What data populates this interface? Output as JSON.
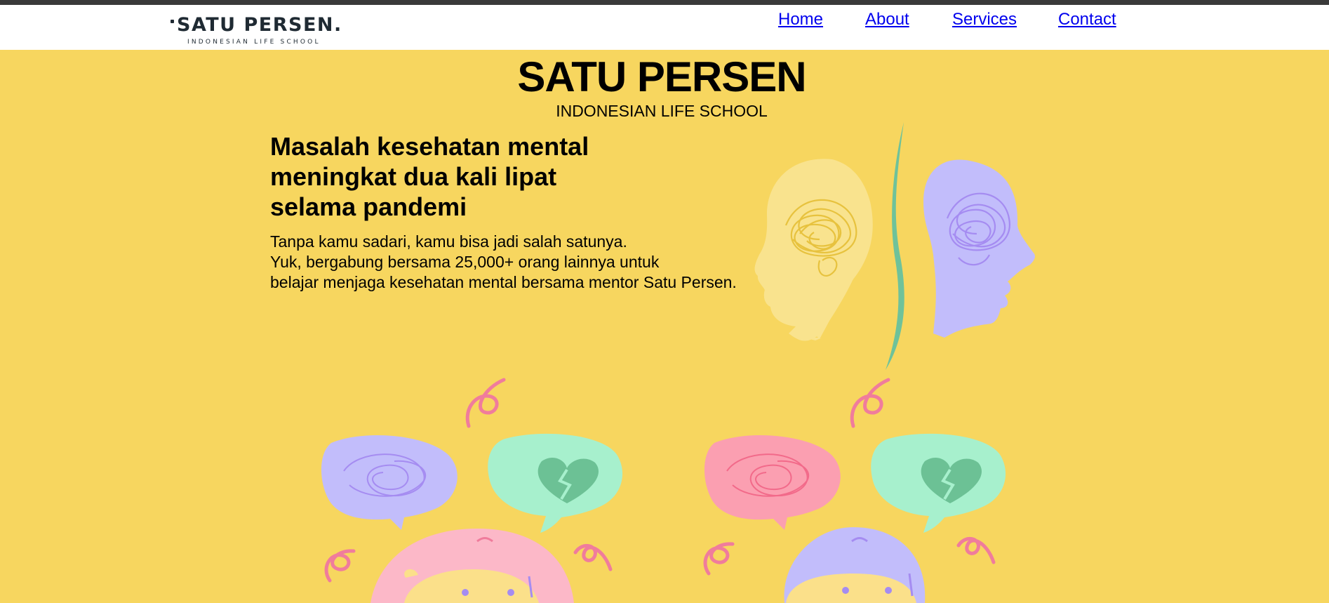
{
  "nav": {
    "logo": {
      "name": "SATU PERSEN",
      "suffix": ".",
      "tagline": "INDONESIAN LIFE SCHOOL"
    },
    "links": [
      "Home",
      "About",
      "Services",
      "Contact"
    ]
  },
  "hero": {
    "title": "SATU PERSEN",
    "subtitle": "INDONESIAN LIFE SCHOOL",
    "headline": [
      "Masalah kesehatan mental",
      "meningkat dua kali lipat",
      "selama pandemi"
    ],
    "description": [
      "Tanpa kamu sadari, kamu bisa jadi salah satunya.",
      "Yuk, bergabung bersama 25,000+ orang lainnya untuk",
      "belajar menjaga kesehatan mental bersama mentor Satu Persen."
    ]
  },
  "colors": {
    "hero_bg": "#f7d65f",
    "top_stripe": "#3a3a3a",
    "link": "#0000ee",
    "logo_text": "#1f2a33",
    "head_yellow": "#f9e38e",
    "head_purple": "#c2bdfb",
    "green_line": "#6fc29a",
    "bubble_purple": "#c2bdfb",
    "bubble_mint": "#a7f0cd",
    "bubble_pink": "#fb9fb1",
    "heart_green": "#6cc195",
    "swirl_pink": "#f07c9c",
    "girl_hair": "#fcb8c8",
    "boy_hair": "#c2bdfb",
    "face": "#fbe08a"
  },
  "icons": [
    "tangled-thoughts-icon",
    "broken-heart-icon",
    "swirl-icon"
  ]
}
